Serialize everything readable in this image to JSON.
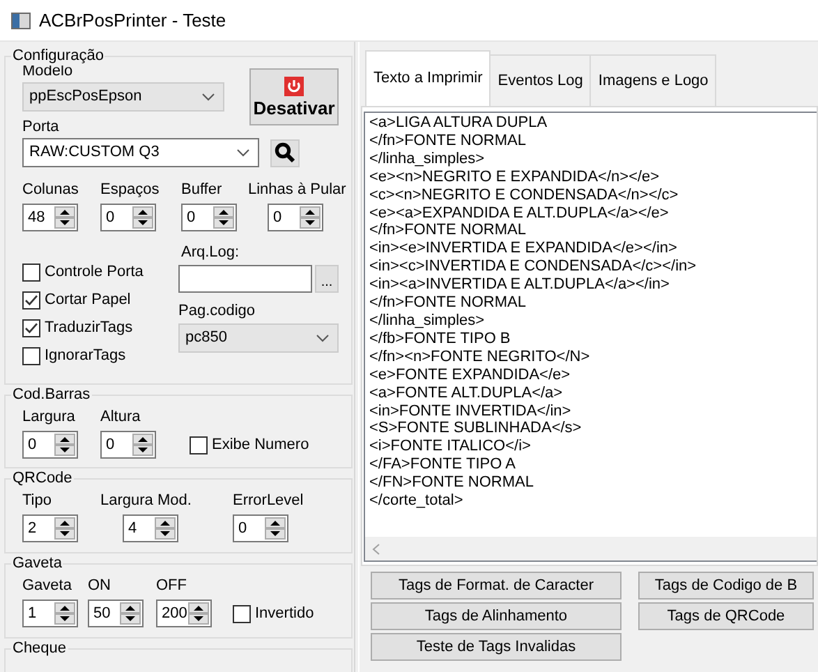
{
  "window": {
    "title": "ACBrPosPrinter - Teste"
  },
  "configuracao": {
    "title": "Configuração",
    "modelo": {
      "label": "Modelo",
      "value": "ppEscPosEpson"
    },
    "desativar_button": "Desativar",
    "porta": {
      "label": "Porta",
      "value": "RAW:CUSTOM Q3"
    },
    "spins": [
      {
        "label": "Colunas",
        "value": "48"
      },
      {
        "label": "Espaços",
        "value": "0"
      },
      {
        "label": "Buffer",
        "value": "0"
      },
      {
        "label": "Linhas à Pular",
        "value": "0"
      }
    ],
    "checkboxes": [
      {
        "label": "Controle Porta",
        "checked": false
      },
      {
        "label": "Cortar Papel",
        "checked": true
      },
      {
        "label": "TraduzirTags",
        "checked": true
      },
      {
        "label": "IgnorarTags",
        "checked": false
      }
    ],
    "arq_log": {
      "label": "Arq.Log:",
      "button": "..."
    },
    "pag_codigo": {
      "label": "Pag.codigo",
      "value": "pc850"
    }
  },
  "cod_barras": {
    "title": "Cod.Barras",
    "spins": [
      {
        "label": "Largura",
        "value": "0"
      },
      {
        "label": "Altura",
        "value": "0"
      }
    ],
    "checkbox": {
      "label": "Exibe Numero",
      "checked": false
    }
  },
  "qrcode": {
    "title": "QRCode",
    "spins": [
      {
        "label": "Tipo",
        "value": "2"
      },
      {
        "label": "Largura Mod.",
        "value": "4"
      },
      {
        "label": "ErrorLevel",
        "value": "0"
      }
    ]
  },
  "gaveta": {
    "title": "Gaveta",
    "spins": [
      {
        "label": "Gaveta",
        "value": "1"
      },
      {
        "label": "ON",
        "value": "50"
      },
      {
        "label": "OFF",
        "value": "200"
      }
    ],
    "checkbox": {
      "label": "Invertido",
      "checked": false
    }
  },
  "cheque": {
    "title": "Cheque"
  },
  "tabs": [
    {
      "label": "Texto a Imprimir",
      "selected": true
    },
    {
      "label": "Eventos Log",
      "selected": false
    },
    {
      "label": "Imagens e Logo",
      "selected": false
    }
  ],
  "memo": {
    "lines": [
      "<a>LIGA ALTURA DUPLA",
      "</fn>FONTE NORMAL",
      "</linha_simples>",
      "<e><n>NEGRITO E EXPANDIDA</n></e>",
      "<c><n>NEGRITO E CONDENSADA</n></c>",
      "<e><a>EXPANDIDA E ALT.DUPLA</a></e>",
      "</fn>FONTE NORMAL",
      "<in><e>INVERTIDA E EXPANDIDA</e></in>",
      "<in><c>INVERTIDA E CONDENSADA</c></in>",
      "<in><a>INVERTIDA E ALT.DUPLA</a></in>",
      "</fn>FONTE NORMAL",
      "</linha_simples>",
      "</fb>FONTE TIPO B",
      "</fn><n>FONTE NEGRITO</N>",
      "<e>FONTE EXPANDIDA</e>",
      "<a>FONTE ALT.DUPLA</a>",
      "<in>FONTE INVERTIDA</in>",
      "<S>FONTE SUBLINHADA</s>",
      "<i>FONTE ITALICO</i>",
      "</FA>FONTE TIPO A",
      "</FN>FONTE NORMAL",
      "</corte_total>"
    ]
  },
  "buttons": [
    {
      "label": "Tags de Format. de Caracter"
    },
    {
      "label": "Tags de Codigo de B"
    },
    {
      "label": "Tags de Alinhamento"
    },
    {
      "label": "Tags de QRCode"
    },
    {
      "label": "Teste de Tags Invalidas"
    }
  ]
}
